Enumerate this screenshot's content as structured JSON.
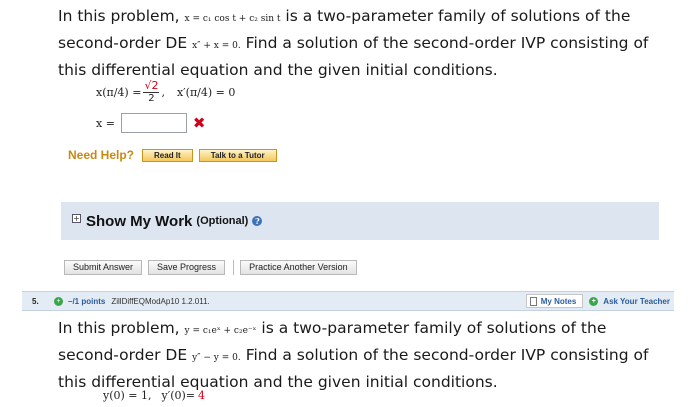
{
  "q4": {
    "intro": "In this problem,",
    "family_eq": "x = c₁ cos t + c₂ sin t",
    "mid1": "is a two-parameter family of solutions of the second-order DE",
    "de_eq": "x″ + x = 0.",
    "rest": "Find a solution of the second-order IVP consisting of this differential equation and the given initial conditions.",
    "ic1_lhs": "x(π/4) =",
    "ic1_num": "√2",
    "ic1_den": "2",
    "ic1_comma": ",",
    "ic2": "x′(π/4) = 0",
    "answer_label": "x =",
    "answer_value": "",
    "wrong_mark": "✖"
  },
  "help": {
    "label": "Need Help?",
    "read_it": "Read It",
    "talk_tutor": "Talk to a Tutor"
  },
  "show_work": {
    "toggle": "+",
    "title": "Show My Work",
    "optional": "(Optional)",
    "info": "?"
  },
  "actions": {
    "submit": "Submit Answer",
    "save": "Save Progress",
    "practice": "Practice Another Version"
  },
  "q5": {
    "number": "5.",
    "status_icon": "+",
    "points": "–/1 points",
    "id": "ZillDiffEQModAp10 1.2.011.",
    "my_notes": "My Notes",
    "ask_icon": "+",
    "ask_teacher": "Ask Your Teacher",
    "intro": "In this problem,",
    "family_eq": "y = c₁eˣ + c₂e⁻ˣ",
    "mid1": "is a two-parameter family of solutions of the second-order DE",
    "de_eq": "y″ − y = 0.",
    "rest": "Find a solution of the second-order IVP consisting of this differential equation and the given initial conditions.",
    "ic1": "y(0) = 1,",
    "ic2_lhs": "y′(0)=",
    "ic2_value": "4"
  },
  "colors": {
    "need_help": "#c98a12",
    "error_red": "#d0021b",
    "panel_blue": "#dde6f0",
    "header_blue": "#e3ebf4",
    "link_blue": "#2b5d9c"
  }
}
